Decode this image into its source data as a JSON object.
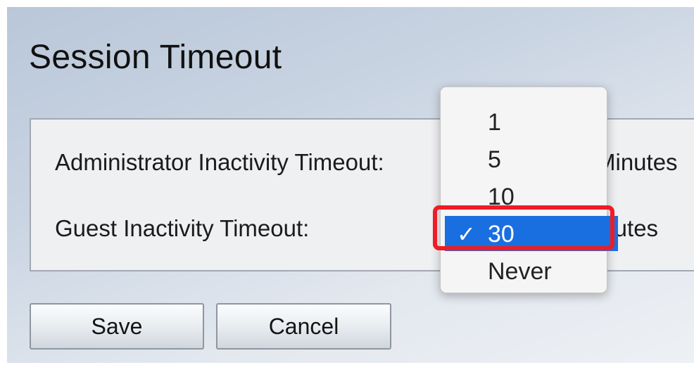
{
  "page": {
    "title": "Session Timeout"
  },
  "settings": {
    "admin_label": "Administrator Inactivity Timeout:",
    "admin_units": "Minutes",
    "guest_label": "Guest Inactivity Timeout:",
    "guest_units": "inutes"
  },
  "dropdown": {
    "options": [
      "1",
      "5",
      "10",
      "30",
      "Never"
    ],
    "selected": "30",
    "check_glyph": "✓"
  },
  "buttons": {
    "save_label": "Save",
    "cancel_label": "Cancel"
  },
  "colors": {
    "selection": "#1a6fe0",
    "annotation_highlight": "#ee1c25"
  }
}
